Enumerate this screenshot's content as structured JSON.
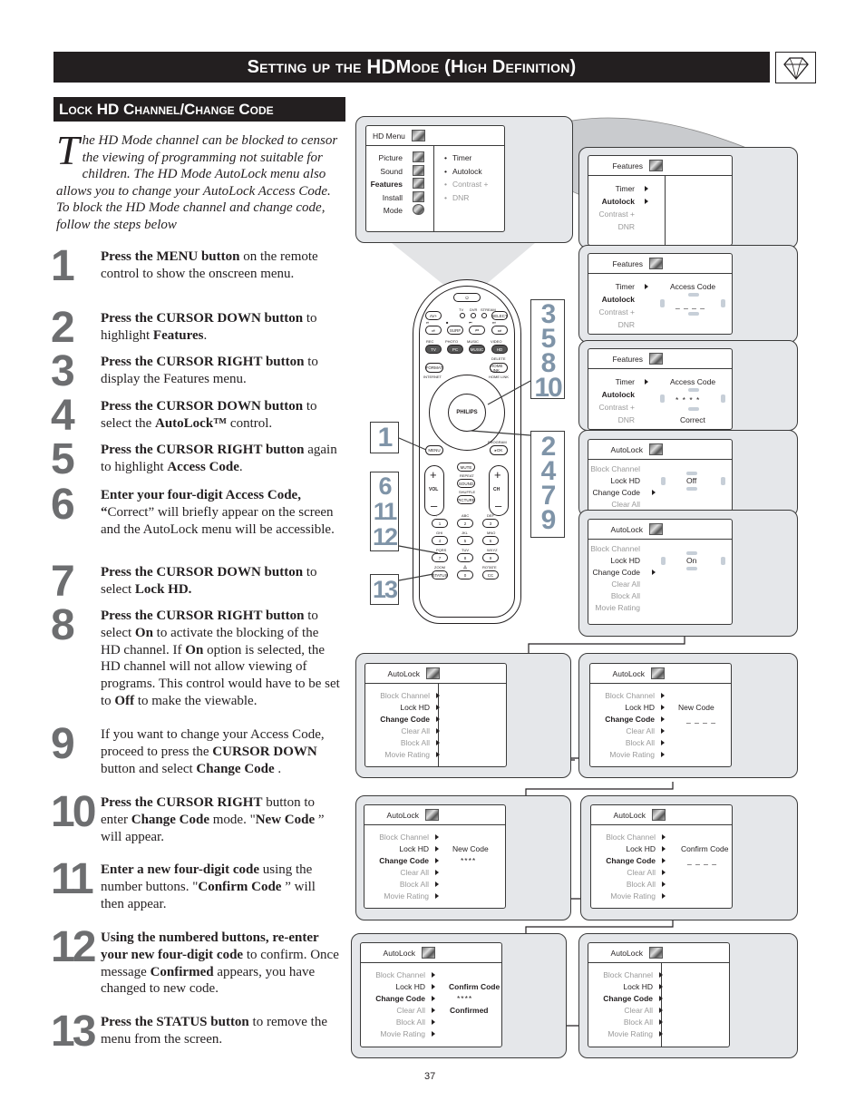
{
  "header": {
    "title_parts": [
      "Setting up the ",
      "HD",
      " Mode (High Definition)"
    ],
    "icon": "diamond-icon"
  },
  "section": {
    "title": "Lock HD Channel/Change Code"
  },
  "intro": {
    "dropcap": "T",
    "text": "he HD Mode channel can be blocked to censor the viewing of programming not suitable for children. The HD Mode AutoLock menu also allows you to change your AutoLock Access Code. To block the HD Mode channel and change code, follow the steps below"
  },
  "steps": [
    {
      "num": "1",
      "html": "<b>Press the MENU button</b> on the remote control to show the onscreen menu."
    },
    {
      "num": "2",
      "html": "<b>Press the CURSOR DOWN button</b> to highlight <b>Features</b>."
    },
    {
      "num": "3",
      "html": "<b>Press the CURSOR RIGHT button</b> to display the Features menu."
    },
    {
      "num": "4",
      "html": "<b>Press the CURSOR DOWN button</b> to select the <b>AutoLock™</b> control."
    },
    {
      "num": "5",
      "html": "<b>Press the CURSOR RIGHT button</b> again to highlight <b>Access Code</b>."
    },
    {
      "num": "6",
      "html": "<b>Enter your four-digit Access Code, “</b>Correct” will briefly appear on the screen and the AutoLock menu will be accessible."
    },
    {
      "num": "7",
      "html": "<b>Press the CURSOR DOWN button</b> to select <b>Lock HD.</b>"
    },
    {
      "num": "8",
      "html": "<b>Press the CURSOR RIGHT button</b> to select <b>On</b> to activate the blocking of the HD channel.  If <b>On</b> option is selected, the HD channel will not allow viewing of programs. This control would have to be set to <b>Off</b> to make the viewable."
    },
    {
      "num": "9",
      "html": "If you want to change your Access Code, proceed to press the <b>CURSOR DOWN</b> button and select <b>Change Code</b> ."
    },
    {
      "num": "10",
      "html": "<b>Press the CURSOR RIGHT</b> button to enter <b>Change Code</b> mode. \"<b>New Code</b> ” will appear."
    },
    {
      "num": "11",
      "html": "<b>Enter a new four-digit code</b> using the number buttons. \"<b>Confirm Code</b> ” will then appear."
    },
    {
      "num": "12",
      "html": "<b>Using the numbered buttons, re-enter your new four-digit code</b> to confirm. Once message <b>Confirmed</b> appears, you have changed to new code."
    },
    {
      "num": "13",
      "html": "<b>Press the STATUS button</b> to remove the menu from the screen."
    }
  ],
  "hd_menu": {
    "title": "HD Menu",
    "left_items": [
      {
        "label": "Picture",
        "bold": false
      },
      {
        "label": "Sound",
        "bold": false
      },
      {
        "label": "Features",
        "bold": true
      },
      {
        "label": "Install",
        "bold": false
      },
      {
        "label": "Mode",
        "bold": false
      }
    ],
    "right_items": [
      {
        "label": "Timer",
        "dim": false
      },
      {
        "label": "Autolock",
        "dim": false
      },
      {
        "label": "Contrast +",
        "dim": true
      },
      {
        "label": "DNR",
        "dim": true
      }
    ]
  },
  "features_items": [
    {
      "label": "Timer",
      "dim": false,
      "bold": false
    },
    {
      "label": "Autolock",
      "dim": false,
      "bold": true
    },
    {
      "label": "Contrast +",
      "dim": true,
      "bold": false
    },
    {
      "label": "DNR",
      "dim": true,
      "bold": false
    }
  ],
  "features_screens": [
    {
      "title": "Features",
      "access_label": "",
      "code": "",
      "status": ""
    },
    {
      "title": "Features",
      "access_label": "Access Code",
      "code": "_ _ _ _",
      "status": ""
    },
    {
      "title": "Features",
      "access_label": "Access Code",
      "code": "* * * *",
      "status": "Correct"
    }
  ],
  "autolock_items": [
    {
      "label": "Block Channel",
      "dim": true,
      "bold": false
    },
    {
      "label": "Lock HD",
      "dim": false,
      "bold": false
    },
    {
      "label": "Change Code",
      "dim": false,
      "bold": false
    },
    {
      "label": "Clear All",
      "dim": true,
      "bold": false
    },
    {
      "label": "Block All",
      "dim": true,
      "bold": false
    },
    {
      "label": "Movie Rating",
      "dim": true,
      "bold": false
    }
  ],
  "autolock_toggle_screens": [
    {
      "title": "AutoLock",
      "value": "Off"
    },
    {
      "title": "AutoLock",
      "value": "On"
    }
  ],
  "autolock_code_screens": [
    {
      "title": "AutoLock",
      "label": "",
      "code": "",
      "status": ""
    },
    {
      "title": "AutoLock",
      "label": "New Code",
      "code": "_ _ _ _",
      "status": ""
    },
    {
      "title": "AutoLock",
      "label": "New Code",
      "code": "****",
      "status": ""
    },
    {
      "title": "AutoLock",
      "label": "Confirm Code",
      "code": "_ _ _ _",
      "status": ""
    },
    {
      "title": "AutoLock",
      "label": "Confirm Code",
      "code": "****",
      "status": "Confirmed"
    },
    {
      "title": "AutoLock",
      "label": "",
      "code": "",
      "status": ""
    }
  ],
  "remote": {
    "brand": "PHILIPS",
    "buttons": {
      "power": "⏻",
      "av": "AV+",
      "select": "SELECT",
      "tv_modes": [
        "TV",
        "DVR",
        "STREAM"
      ],
      "play": "⏯",
      "stop": "■",
      "prev": "⏮",
      "next": "⏭",
      "surf": "SURF",
      "tv": "TV",
      "pc": "PC",
      "hd": "HD",
      "rec": "REC",
      "photo": "PHOTO",
      "music": "MUSIC",
      "video": "VIDEO",
      "format": "FORMAT",
      "internet": "INTERNET",
      "delete": "DELETE",
      "homelink": "HOME LINK",
      "menu": "MENU",
      "program": "PROGRAM",
      "ok": "▸OK",
      "mute": "MUTE",
      "repeat": "REPEAT",
      "sound": "SOUND",
      "shuffle": "SHUFFLE",
      "picture": "PICTURE",
      "vol": "VOL",
      "ch": "CH",
      "plus": "+",
      "minus": "–",
      "digits": [
        "1",
        "2",
        "3",
        "4",
        "5",
        "6",
        "7",
        "8",
        "9",
        "0"
      ],
      "digit_labels": [
        ".",
        "ABC",
        "DEF",
        "GHI",
        "JKL",
        "MNO",
        "PQRS",
        "TUV",
        "WXYZ",
        "⁂"
      ],
      "zoom": "ZOOM",
      "status": "STATUS",
      "rotate": "ROTATE",
      "cc": "CC"
    }
  },
  "callouts": {
    "top_right": [
      "3",
      "5",
      "8",
      "10"
    ],
    "mid_right": [
      "2",
      "4",
      "7",
      "9"
    ],
    "top_left": [
      "1"
    ],
    "mid_left": [
      "6",
      "11",
      "12"
    ],
    "bottom_left": [
      "13"
    ]
  },
  "page_number": "37"
}
